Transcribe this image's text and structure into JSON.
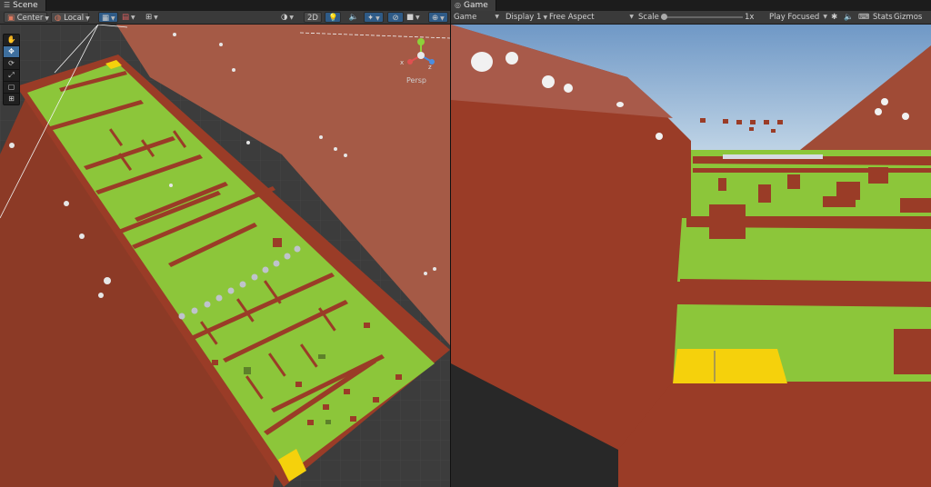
{
  "scene": {
    "tab_label": "Scene",
    "toolbar": {
      "pivot_label": "Center",
      "space_label": "Local",
      "mode_2d_label": "2D"
    },
    "tools": [
      "hand-tool",
      "move-tool",
      "rotate-tool",
      "scale-tool",
      "rect-tool",
      "transform-tool"
    ],
    "gizmo": {
      "x_label": "x",
      "z_label": "z",
      "projection_label": "Persp"
    }
  },
  "game": {
    "tab_label": "Game",
    "toolbar": {
      "view_label": "Game",
      "display_label": "Display 1",
      "aspect_label": "Free Aspect",
      "scale_label": "Scale",
      "scale_value": "1x",
      "play_mode_label": "Play Focused",
      "stats_label": "Stats",
      "gizmos_label": "Gizmos"
    },
    "slider": {
      "scale_fraction": 0.0
    }
  },
  "colors": {
    "ground": "#8cc63a",
    "walls": "#9a3c27",
    "ramp": "#a9503d",
    "goal": "#f5d10c",
    "sky": "#c3d9ea",
    "accent_selected": "#3e6f9e"
  }
}
